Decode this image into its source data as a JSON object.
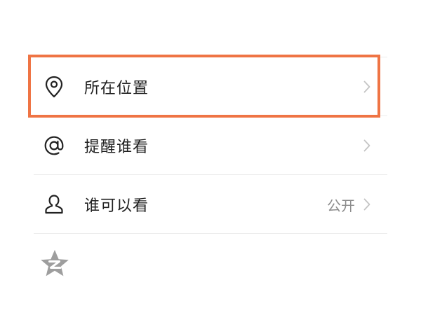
{
  "rows": [
    {
      "label": "所在位置",
      "icon": "location-pin-icon",
      "value": ""
    },
    {
      "label": "提醒谁看",
      "icon": "at-sign-icon",
      "value": ""
    },
    {
      "label": "谁可以看",
      "icon": "person-icon",
      "value": "公开"
    }
  ],
  "colors": {
    "highlight_border": "#ef7444",
    "chevron": "#c4c4c4",
    "value_text": "#8c8c8c",
    "qzone_icon": "#9e9e9e"
  },
  "footer_icon": "qzone-star-icon"
}
